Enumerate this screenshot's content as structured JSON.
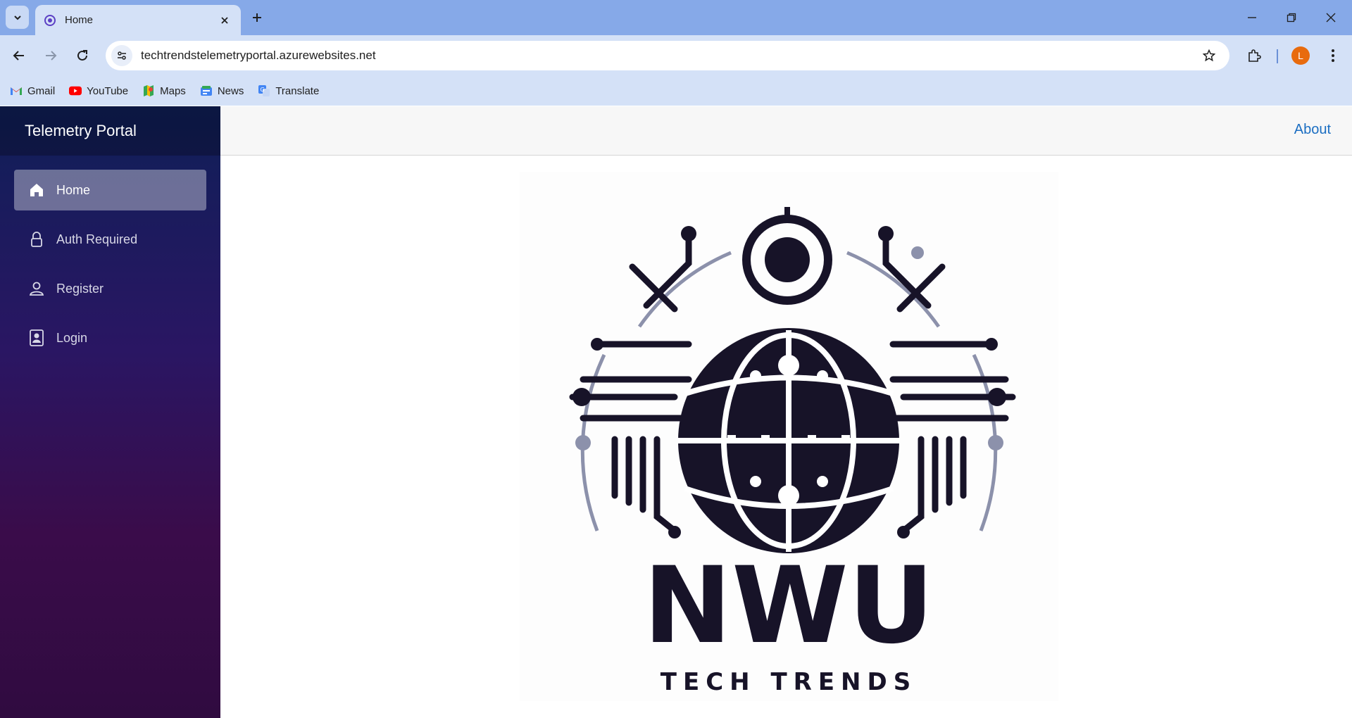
{
  "browser": {
    "tab_title": "Home",
    "url": "techtrendstelemetryportal.azurewebsites.net",
    "profile_initial": "L",
    "accent": "#86a9e8",
    "profile_color": "#e86b0e",
    "bookmarks": [
      {
        "label": "Gmail",
        "icon": "gmail-icon"
      },
      {
        "label": "YouTube",
        "icon": "youtube-icon"
      },
      {
        "label": "Maps",
        "icon": "maps-icon"
      },
      {
        "label": "News",
        "icon": "news-icon"
      },
      {
        "label": "Translate",
        "icon": "translate-icon"
      }
    ]
  },
  "sidebar": {
    "brand": "Telemetry Portal",
    "items": [
      {
        "label": "Home",
        "icon": "home-icon",
        "active": true
      },
      {
        "label": "Auth Required",
        "icon": "lock-icon",
        "active": false
      },
      {
        "label": "Register",
        "icon": "person-icon",
        "active": false
      },
      {
        "label": "Login",
        "icon": "badge-icon",
        "active": false
      }
    ]
  },
  "topbar": {
    "about_label": "About",
    "link_color": "#1b6ec2"
  },
  "logo": {
    "wordmark": "NWU",
    "tagline": "TECH TRENDS"
  }
}
